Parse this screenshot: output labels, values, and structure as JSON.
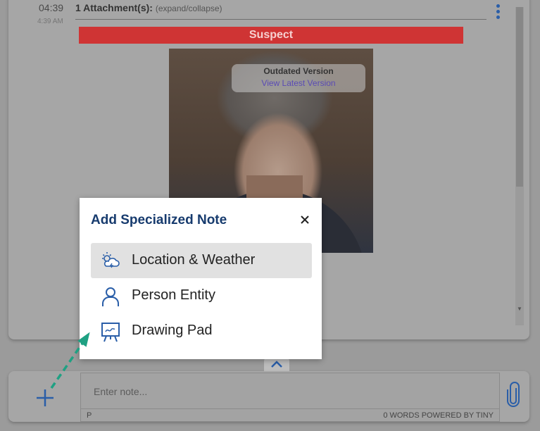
{
  "message": {
    "time": "04:39",
    "time_sub": "4:39 AM",
    "attachments_label": "1 Attachment(s):",
    "attachments_hint": "(expand/collapse)",
    "suspect_label": "Suspect",
    "outdated_title": "Outdated Version",
    "outdated_link": "View Latest Version"
  },
  "dialog": {
    "title": "Add Specialized Note",
    "options": [
      {
        "label": "Location & Weather",
        "icon": "cloud-weather-icon"
      },
      {
        "label": "Person Entity",
        "icon": "person-icon"
      },
      {
        "label": "Drawing Pad",
        "icon": "easel-icon"
      }
    ]
  },
  "composer": {
    "placeholder": "Enter note...",
    "status_path": "P",
    "status_words": "0 WORDS  POWERED BY TINY"
  },
  "colors": {
    "accent": "#2a5ea8",
    "title": "#173b6e",
    "suspect": "#cf3434",
    "arrow": "#1fa183"
  }
}
